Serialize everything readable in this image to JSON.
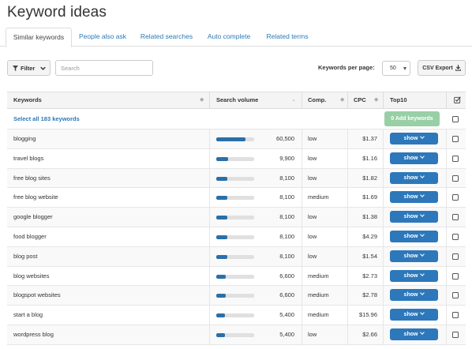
{
  "page": {
    "title": "Keyword ideas"
  },
  "tabs": [
    {
      "label": "Similar keywords",
      "active": true
    },
    {
      "label": "People also ask",
      "active": false
    },
    {
      "label": "Related searches",
      "active": false
    },
    {
      "label": "Auto complete",
      "active": false
    },
    {
      "label": "Related terms",
      "active": false
    }
  ],
  "toolbar": {
    "filter_label": "Filter",
    "search_placeholder": "Search",
    "kpp_label": "Keywords per page:",
    "kpp_value": "50",
    "csv_label": "CSV Export"
  },
  "table": {
    "headers": {
      "keywords": "Keywords",
      "volume": "Search volume",
      "comp": "Comp.",
      "cpc": "CPC",
      "top10": "Top10"
    },
    "select_all": "Select all 183 keywords",
    "add_keywords": "0 Add keywords",
    "show_label": "show",
    "max_volume": 60500,
    "rows": [
      {
        "keyword": "blogging",
        "volume": "60,500",
        "volume_value": 60500,
        "comp": "low",
        "cpc": "$1.37"
      },
      {
        "keyword": "travel blogs",
        "volume": "9,900",
        "volume_value": 9900,
        "comp": "low",
        "cpc": "$1.16"
      },
      {
        "keyword": "free blog sites",
        "volume": "8,100",
        "volume_value": 8100,
        "comp": "low",
        "cpc": "$1.82"
      },
      {
        "keyword": "free blog website",
        "volume": "8,100",
        "volume_value": 8100,
        "comp": "medium",
        "cpc": "$1.69"
      },
      {
        "keyword": "google blogger",
        "volume": "8,100",
        "volume_value": 8100,
        "comp": "low",
        "cpc": "$1.38"
      },
      {
        "keyword": "food blogger",
        "volume": "8,100",
        "volume_value": 8100,
        "comp": "low",
        "cpc": "$4.29"
      },
      {
        "keyword": "blog post",
        "volume": "8,100",
        "volume_value": 8100,
        "comp": "low",
        "cpc": "$1.54"
      },
      {
        "keyword": "blog websites",
        "volume": "6,600",
        "volume_value": 6600,
        "comp": "medium",
        "cpc": "$2.73"
      },
      {
        "keyword": "blogspot websites",
        "volume": "6,600",
        "volume_value": 6600,
        "comp": "medium",
        "cpc": "$2.78"
      },
      {
        "keyword": "start a blog",
        "volume": "5,400",
        "volume_value": 5400,
        "comp": "medium",
        "cpc": "$15.96"
      },
      {
        "keyword": "wordpress blog",
        "volume": "5,400",
        "volume_value": 5400,
        "comp": "low",
        "cpc": "$2.66"
      }
    ]
  },
  "colors": {
    "accent": "#2d78ba",
    "bar": "#2a6fa8",
    "add_button": "#98cfa5",
    "link": "#2a7ab8"
  }
}
